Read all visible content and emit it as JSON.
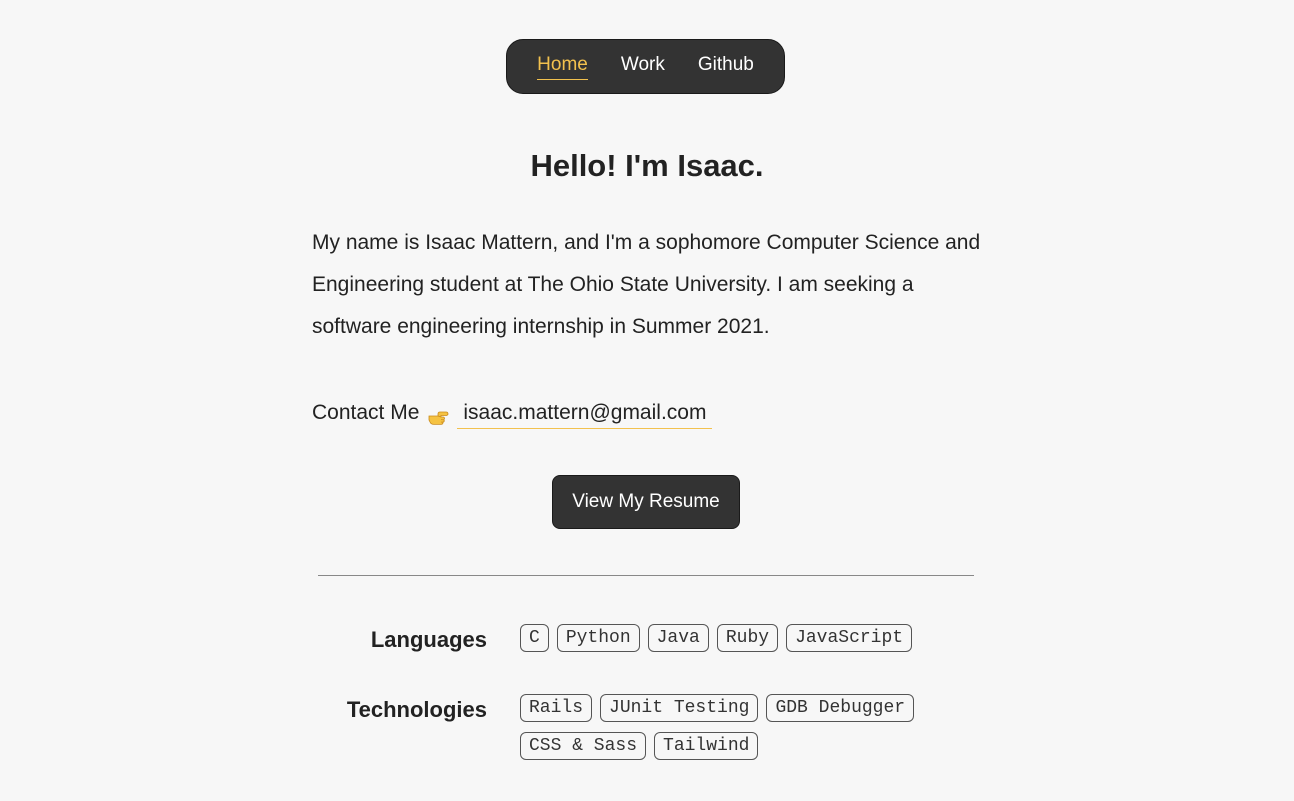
{
  "nav": {
    "items": [
      {
        "label": "Home",
        "active": true
      },
      {
        "label": "Work",
        "active": false
      },
      {
        "label": "Github",
        "active": false
      }
    ]
  },
  "hero": {
    "title": "Hello! I'm Isaac.",
    "intro": "My name is Isaac Mattern, and I'm a sophomore Computer Science and Engineering student at The Ohio State University. I am seeking a software engineering internship in Summer 2021.",
    "contact_label": "Contact Me",
    "contact_icon": "pointing-hand-icon",
    "email": "isaac.mattern@gmail.com",
    "resume_button": "View My Resume"
  },
  "skills": {
    "languages": {
      "label": "Languages",
      "items": [
        "C",
        "Python",
        "Java",
        "Ruby",
        "JavaScript"
      ]
    },
    "technologies": {
      "label": "Technologies",
      "items": [
        "Rails",
        "JUnit Testing",
        "GDB Debugger",
        "CSS & Sass",
        "Tailwind"
      ]
    }
  },
  "colors": {
    "accent": "#f2c14e",
    "dark": "#333333",
    "background": "#f7f7f7"
  }
}
